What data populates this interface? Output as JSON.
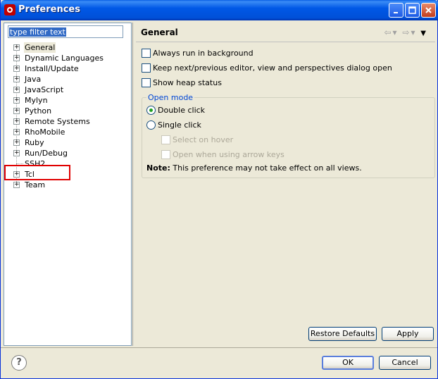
{
  "window": {
    "title": "Preferences",
    "controls": [
      "minimize-icon",
      "maximize-icon",
      "close-icon"
    ]
  },
  "filter": {
    "value": "type filter text"
  },
  "tree": {
    "items": [
      {
        "label": "General",
        "expandable": true,
        "selected": true
      },
      {
        "label": "Dynamic Languages",
        "expandable": true
      },
      {
        "label": "Install/Update",
        "expandable": true
      },
      {
        "label": "Java",
        "expandable": true
      },
      {
        "label": "JavaScript",
        "expandable": true
      },
      {
        "label": "Mylyn",
        "expandable": true
      },
      {
        "label": "Python",
        "expandable": true
      },
      {
        "label": "Remote Systems",
        "expandable": true
      },
      {
        "label": "RhoMobile",
        "expandable": true,
        "highlighted": true
      },
      {
        "label": "Ruby",
        "expandable": true
      },
      {
        "label": "Run/Debug",
        "expandable": true
      },
      {
        "label": "SSH2",
        "expandable": false
      },
      {
        "label": "Tcl",
        "expandable": true
      },
      {
        "label": "Team",
        "expandable": true
      }
    ]
  },
  "page": {
    "title": "General",
    "options": {
      "always_run_background": {
        "label": "Always run in background",
        "checked": false
      },
      "keep_next_previous": {
        "label": "Keep next/previous editor, view and perspectives dialog open",
        "checked": false
      },
      "show_heap": {
        "label": "Show heap status",
        "checked": false
      }
    },
    "open_mode": {
      "title": "Open mode",
      "double_click": {
        "label": "Double click",
        "selected": true
      },
      "single_click": {
        "label": "Single click",
        "selected": false
      },
      "select_on_hover": {
        "label": "Select on hover",
        "enabled": false
      },
      "open_arrow_keys": {
        "label": "Open when using arrow keys",
        "enabled": false
      },
      "note_label": "Note:",
      "note_text": " This preference may not take effect on all views."
    },
    "restore_defaults": "Restore Defaults",
    "apply": "Apply"
  },
  "footer": {
    "ok": "OK",
    "cancel": "Cancel"
  },
  "colors": {
    "title_bar": "#0054e3",
    "highlight_box": "#e00000",
    "group_title": "#0046d5",
    "radio_dot": "#21a121"
  }
}
